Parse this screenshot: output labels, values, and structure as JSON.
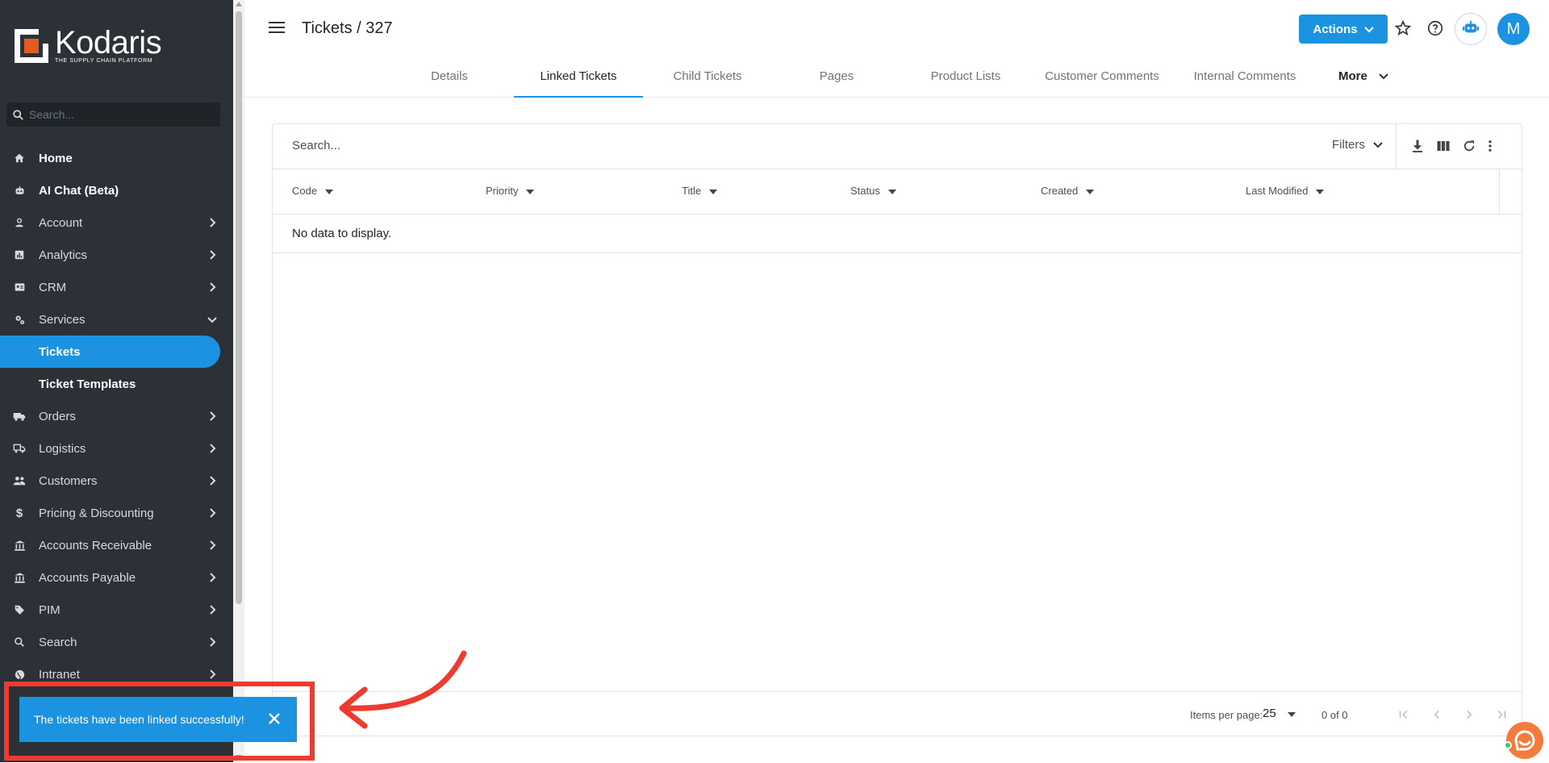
{
  "brand": {
    "name": "Kodaris",
    "tagline": "THE SUPPLY CHAIN PLATFORM"
  },
  "sidebar": {
    "search_placeholder": "Search...",
    "items": [
      {
        "label": "Home",
        "icon": "home-icon"
      },
      {
        "label": "AI Chat (Beta)",
        "icon": "robot-icon"
      },
      {
        "label": "Account",
        "icon": "account-icon"
      },
      {
        "label": "Analytics",
        "icon": "analytics-icon"
      },
      {
        "label": "CRM",
        "icon": "crm-icon"
      },
      {
        "label": "Services",
        "icon": "services-icon"
      },
      {
        "label": "Tickets"
      },
      {
        "label": "Ticket Templates"
      },
      {
        "label": "Orders",
        "icon": "truck-icon"
      },
      {
        "label": "Logistics",
        "icon": "logistics-icon"
      },
      {
        "label": "Customers",
        "icon": "customers-icon"
      },
      {
        "label": "Pricing & Discounting",
        "icon": "dollar-icon"
      },
      {
        "label": "Accounts Receivable",
        "icon": "bank-icon"
      },
      {
        "label": "Accounts Payable",
        "icon": "bank-icon"
      },
      {
        "label": "PIM",
        "icon": "tag-icon"
      },
      {
        "label": "Search",
        "icon": "search-icon"
      },
      {
        "label": "Intranet",
        "icon": "globe-icon"
      }
    ]
  },
  "header": {
    "title": "Tickets / 327",
    "actions_label": "Actions",
    "avatar_initial": "M"
  },
  "tabs": [
    "Details",
    "Linked Tickets",
    "Child Tickets",
    "Pages",
    "Product Lists",
    "Customer Comments",
    "Internal Comments",
    "More"
  ],
  "active_tab": "Linked Tickets",
  "grid": {
    "search_placeholder": "Search...",
    "filters_label": "Filters",
    "columns": [
      "Code",
      "Priority",
      "Title",
      "Status",
      "Created",
      "Last Modified"
    ],
    "empty_message": "No data to display."
  },
  "paginator": {
    "items_per_page_label": "Items per page:",
    "page_size": "25",
    "range_label": "0 of 0"
  },
  "toast": {
    "message": "The tickets have been linked successfully!"
  },
  "colors": {
    "accent": "#1b93e0",
    "sidebar": "#2b3137",
    "highlight": "#ef3b2f"
  }
}
